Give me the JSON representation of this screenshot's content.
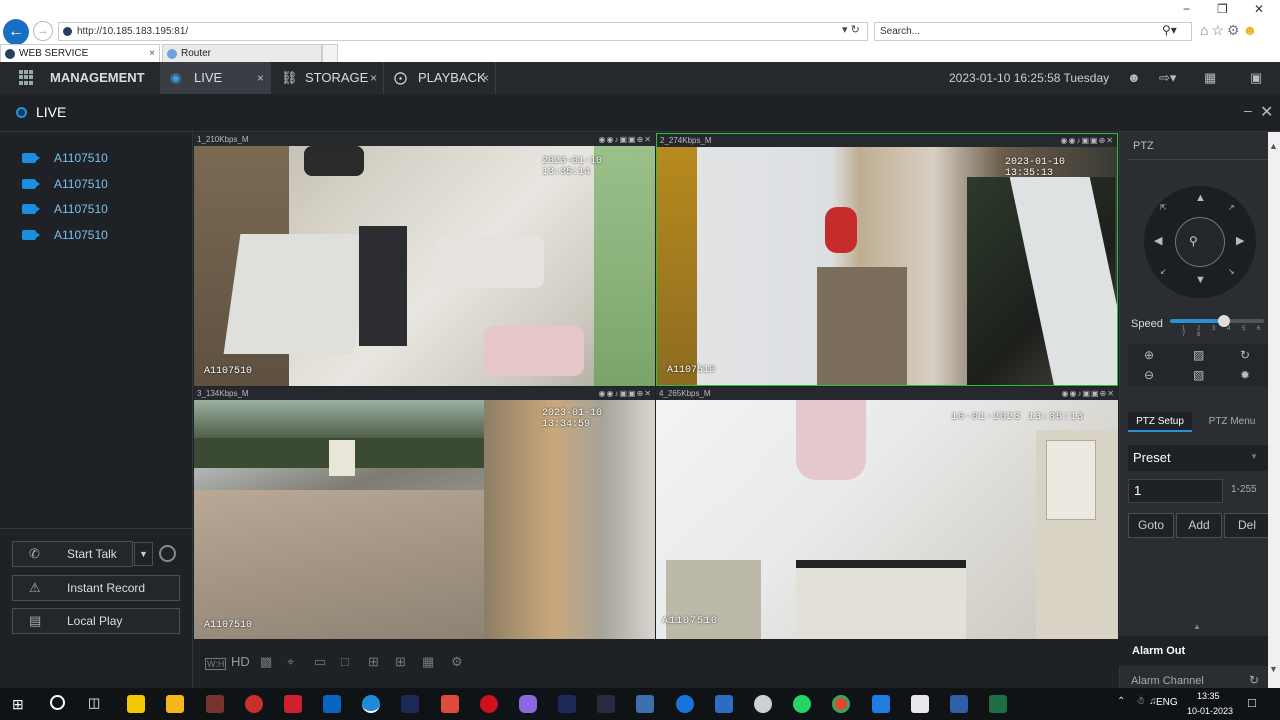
{
  "browser": {
    "address": "http://10.185.183.195:81/",
    "search_placeholder": "Search...",
    "tabs": [
      {
        "label": "WEB SERVICE",
        "close": "×"
      },
      {
        "label": "Router"
      }
    ],
    "window_controls": {
      "minimize": "−",
      "restore": "❐",
      "close": "✕"
    }
  },
  "app": {
    "tabs": [
      {
        "label": "MANAGEMENT"
      },
      {
        "label": "LIVE",
        "close": "×"
      },
      {
        "label": "STORAGE",
        "close": "×"
      },
      {
        "label": "PLAYBACK",
        "close": "×"
      }
    ],
    "datetime": "2023-01-10 16:25:58 Tuesday"
  },
  "live": {
    "title": "LIVE",
    "cameras": [
      "A1107510",
      "A1107510",
      "A1107510",
      "A1107510"
    ],
    "buttons": {
      "talk": "Start Talk",
      "record": "Instant Record",
      "local_play": "Local Play"
    }
  },
  "videos": [
    {
      "header": "1_210Kbps_M",
      "timestamp": "2023-01-10 13:35:14",
      "name": "A1107510"
    },
    {
      "header": "2_274Kbps_M",
      "timestamp": "2023-01-10 13:35:13",
      "name": "A1107510"
    },
    {
      "header": "3_134Kbps_M",
      "timestamp": "2023-01-10 13:34:59",
      "name": "A1107510"
    },
    {
      "header": "4_265Kbps_M",
      "timestamp": "10-01-2023 13:35:13",
      "name": "A1107510"
    }
  ],
  "toolbar": {
    "hd": "HD"
  },
  "ptz": {
    "title": "PTZ",
    "speed_label": "Speed",
    "speed_ticks": "1 2 3 4 5 6 7 8",
    "speed_value": 5,
    "tabs": [
      "PTZ Setup",
      "PTZ Menu"
    ],
    "preset_label": "Preset",
    "preset_value": "1",
    "preset_range": "1-255",
    "actions": [
      "Goto",
      "Add",
      "Del"
    ],
    "alarm_out": "Alarm Out",
    "alarm_channel": "Alarm Channel"
  },
  "taskbar": {
    "lang": "ENG",
    "time": "13:35",
    "date": "10-01-2023"
  }
}
